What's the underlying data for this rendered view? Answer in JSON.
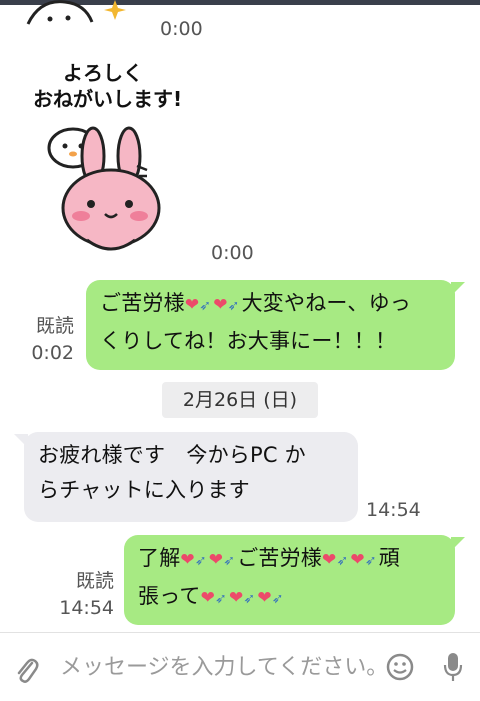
{
  "chat": {
    "top_time": "0:00",
    "sticker": {
      "caption_line1": "よろしく",
      "caption_line2": "おねがいします!",
      "time": "0:00"
    },
    "msg1": {
      "read_label": "既読",
      "read_time": "0:02",
      "text_a": "ご苦労様",
      "text_b": "大変やねー、ゆっ",
      "text_c": "くりしてね！お大事にー！！！"
    },
    "date_divider": "2月26日 (日)",
    "msg2": {
      "line1": "お疲れ様です　今からPC か",
      "line2": "らチャットに入ります",
      "time": "14:54"
    },
    "msg3": {
      "read_label": "既読",
      "read_time": "14:54",
      "text_a": "了解",
      "text_b": "ご苦労様",
      "text_c": "頑",
      "text_d": "張って"
    }
  },
  "input": {
    "placeholder": "メッセージを入力してください。",
    "icons": [
      "paperclip-icon",
      "emoji-icon",
      "microphone-icon"
    ]
  },
  "colors": {
    "outgoing_bubble": "#a7ea83",
    "incoming_bubble": "#ececf0",
    "heart": "#ec4a6a"
  }
}
